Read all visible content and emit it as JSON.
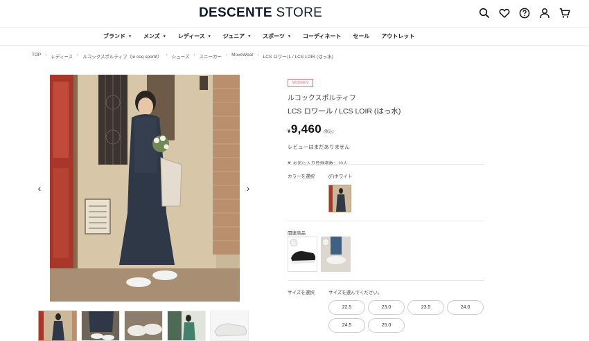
{
  "header": {
    "logo_bold": "DESCENTE",
    "logo_light": "STORE",
    "icons": [
      "search-icon",
      "heart-icon",
      "help-icon",
      "user-icon",
      "cart-icon"
    ]
  },
  "nav": {
    "items": [
      {
        "label": "ブランド",
        "caret": "▼"
      },
      {
        "label": "メンズ",
        "caret": "▼"
      },
      {
        "label": "レディース",
        "caret": "▼"
      },
      {
        "label": "ジュニア",
        "caret": "▼"
      },
      {
        "label": "スポーツ",
        "caret": "▼"
      },
      {
        "label": "コーディネート",
        "caret": ""
      },
      {
        "label": "セール",
        "caret": ""
      },
      {
        "label": "アウトレット",
        "caret": ""
      }
    ]
  },
  "breadcrumb": {
    "sep": "›",
    "items": [
      "TOP",
      "レディース",
      "ルコックスポルティフ（le coq sportif）",
      "シューズ",
      "スニーカー",
      "MoveWear",
      "LCS ロワール / LCS LOIR (はっ水)"
    ]
  },
  "product": {
    "badge": "WOMEN",
    "brand": "ルコックスポルティフ",
    "name": "LCS ロワール / LCS LOIR (はっ水)",
    "yen": "¥",
    "price": "9,460",
    "tax": "(税込)",
    "review": "レビューはまだありません",
    "favorites": "お気に入り登録者数：10人"
  },
  "gallery": {
    "prev": "‹",
    "next": "›",
    "thumb_count": 5
  },
  "color": {
    "label": "カラーを選択",
    "selected": "(F)ホワイト"
  },
  "related": {
    "label": "関連商品"
  },
  "size": {
    "label": "サイズを選択",
    "prompt": "サイズを選んでください。",
    "options": [
      "22.5",
      "23.0",
      "23.5",
      "24.0",
      "24.5",
      "25.0"
    ]
  },
  "colors": {
    "badge": "#e0707a",
    "logo": "#0f1b2d"
  }
}
